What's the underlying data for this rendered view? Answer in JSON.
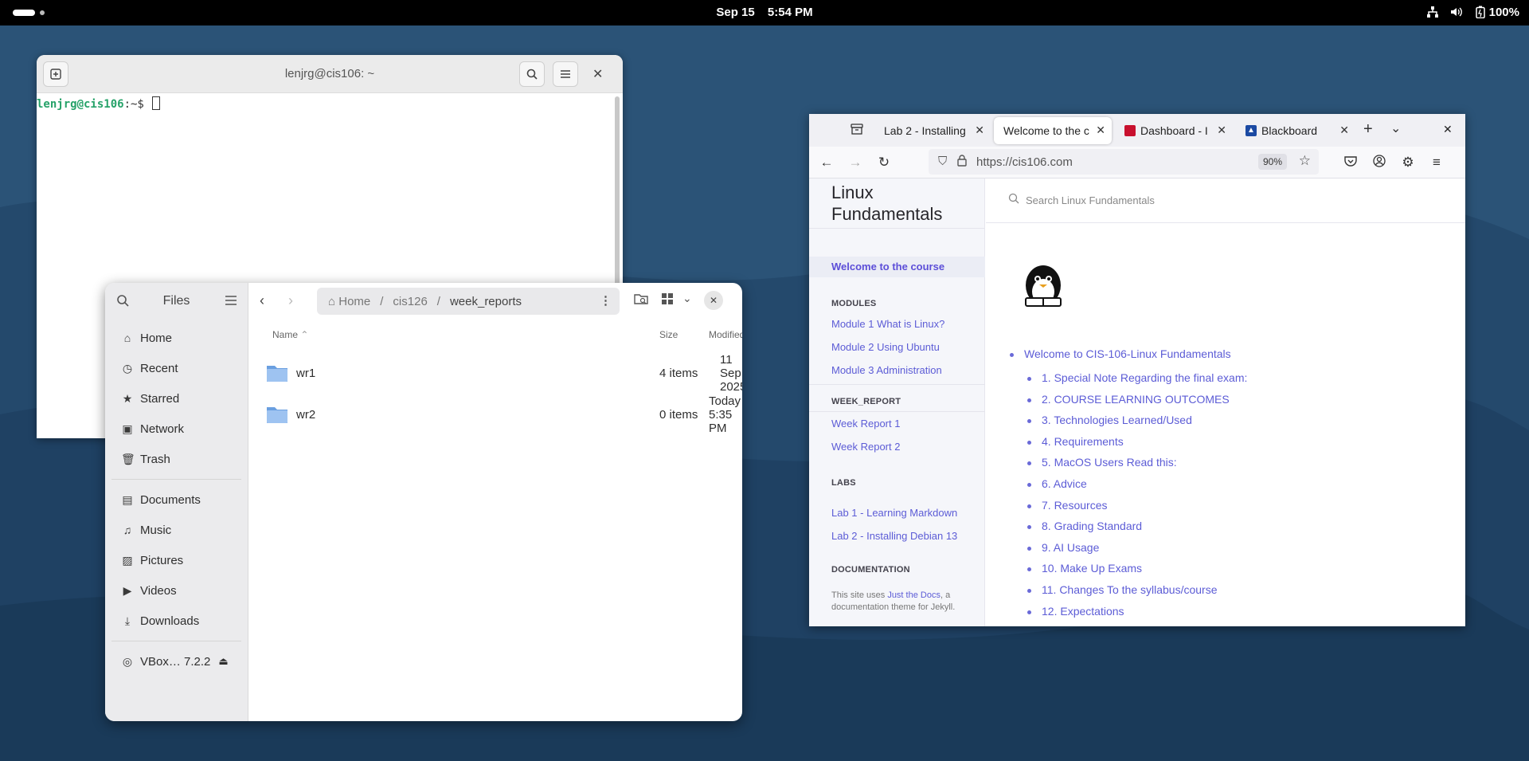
{
  "topbar": {
    "date": "Sep 15",
    "time": "5:54 PM",
    "battery": "100%"
  },
  "terminal": {
    "title": "lenjrg@cis106: ~",
    "prompt_user": "lenjrg@cis106",
    "prompt_sep": ":~$ "
  },
  "files": {
    "title": "Files",
    "sidebar": {
      "places": [
        "Home",
        "Recent",
        "Starred",
        "Network",
        "Trash"
      ],
      "bookmarks": [
        "Documents",
        "Music",
        "Pictures",
        "Videos",
        "Downloads"
      ],
      "device": "VBox… 7.2.2"
    },
    "breadcrumb": [
      "Home",
      "cis126",
      "week_reports"
    ],
    "columns": {
      "name": "Name",
      "size": "Size",
      "modified": "Modified"
    },
    "rows": [
      {
        "name": "wr1",
        "size": "4 items",
        "modified": "11 Sep 2025"
      },
      {
        "name": "wr2",
        "size": "0 items",
        "modified": "Today 5:35 PM"
      }
    ]
  },
  "browser": {
    "tabs": [
      {
        "label": "Lab 2 - Installing"
      },
      {
        "label": "Welcome to the c"
      },
      {
        "label": "Dashboard - I"
      },
      {
        "label": "Blackboard"
      }
    ],
    "url": "https://cis106.com",
    "zoom": "90%",
    "page": {
      "brand_line1": "Linux",
      "brand_line2": "Fundamentals",
      "search_placeholder": "Search Linux Fundamentals",
      "nav_active": "Welcome to the course",
      "sections": [
        {
          "title": "MODULES",
          "links": [
            "Module 1 What is Linux?",
            "Module 2 Using Ubuntu",
            "Module 3 Administration"
          ]
        },
        {
          "title": "WEEK_REPORT",
          "links": [
            "Week Report 1",
            "Week Report 2"
          ]
        },
        {
          "title": "LABS",
          "links": [
            "Lab 1 - Learning Markdown",
            "Lab 2 - Installing Debian 13"
          ]
        },
        {
          "title": "DOCUMENTATION",
          "links": []
        }
      ],
      "footer_pre": "This site uses ",
      "footer_link": "Just the Docs",
      "footer_post": ", a documentation theme for Jekyll.",
      "toc_top": "Welcome to CIS-106-Linux Fundamentals",
      "toc_items": [
        "1. Special Note Regarding the final exam:",
        "2. COURSE LEARNING OUTCOMES",
        "3. Technologies Learned/Used",
        "4. Requirements",
        "5. MacOS Users Read this:",
        "6. Advice",
        "7. Resources",
        "8. Grading Standard",
        "9. AI Usage",
        "10. Make Up Exams",
        "11. Changes To the syllabus/course",
        "12. Expectations"
      ]
    }
  }
}
